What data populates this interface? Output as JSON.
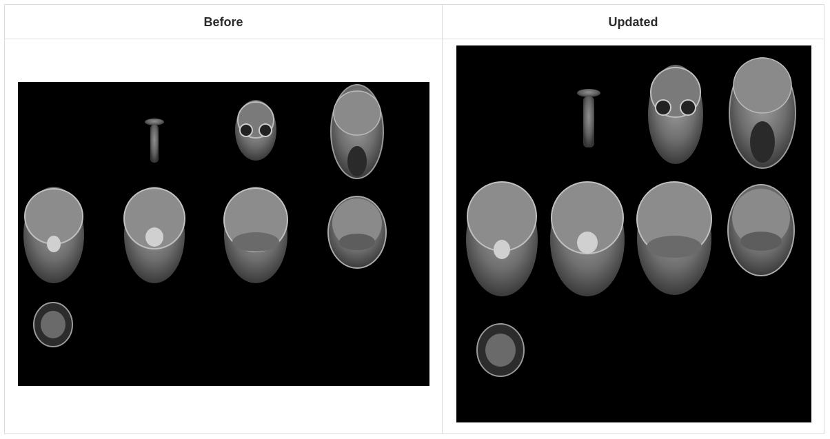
{
  "table": {
    "columns": [
      {
        "header": "Before"
      },
      {
        "header": "Updated"
      }
    ]
  },
  "images": {
    "before": {
      "description_icon": "mri-montage-icon"
    },
    "updated": {
      "description_icon": "mri-montage-icon"
    }
  },
  "colors": {
    "border": "#dcdcdc",
    "header_text": "#2b2b2b",
    "scan_background": "#000000",
    "tissue": "#8a8a8a"
  }
}
